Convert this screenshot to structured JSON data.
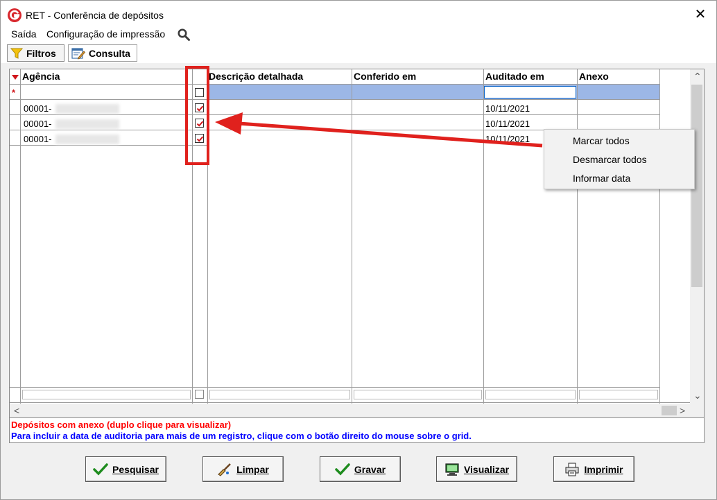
{
  "window": {
    "title": "RET - Conferência de depósitos",
    "close_label": "✕"
  },
  "menu": {
    "items": [
      "Saída",
      "Configuração de impressão"
    ]
  },
  "tabs": [
    {
      "label": "Filtros",
      "icon": "funnel-icon"
    },
    {
      "label": "Consulta",
      "icon": "edit-form-icon"
    }
  ],
  "grid": {
    "columns": [
      "Agência",
      "",
      "Descrição detalhada",
      "Conferido em",
      "Auditado em",
      "Anexo"
    ],
    "new_row_marker": "*",
    "rows": [
      {
        "agencia": "00001-",
        "checked": true,
        "descricao": "",
        "conferido": "",
        "auditado": "10/11/2021",
        "anexo": ""
      },
      {
        "agencia": "00001-",
        "checked": true,
        "descricao": "",
        "conferido": "",
        "auditado": "10/11/2021",
        "anexo": ""
      },
      {
        "agencia": "00001-",
        "checked": true,
        "descricao": "",
        "conferido": "",
        "auditado": "10/11/2021",
        "anexo": ""
      }
    ],
    "scroll_left_glyph": "<",
    "scroll_right_glyph": ">",
    "scroll_down_glyph": "⌄",
    "scroll_up_glyph": "⌃"
  },
  "legend": {
    "attachment_note": "Depósitos com anexo (duplo clique para visualizar)",
    "audit_note": "Para incluir a data de auditoria para mais de um registro, clique com o botão direito do mouse sobre o grid."
  },
  "context_menu": {
    "items": [
      "Marcar todos",
      "Desmarcar todos",
      "Informar data"
    ]
  },
  "buttons": [
    {
      "label": "Pesquisar",
      "icon": "checkmark-icon"
    },
    {
      "label": "Limpar",
      "icon": "broom-icon"
    },
    {
      "label": "Gravar",
      "icon": "checkmark-icon"
    },
    {
      "label": "Visualizar",
      "icon": "monitor-icon"
    },
    {
      "label": "Imprimir",
      "icon": "printer-icon"
    }
  ],
  "colors": {
    "annotation_red": "#e0211d",
    "selected_row": "#9cb7e6",
    "legend_red": "#ff0000",
    "legend_blue": "#0000ff",
    "check_red": "#d0161b"
  }
}
